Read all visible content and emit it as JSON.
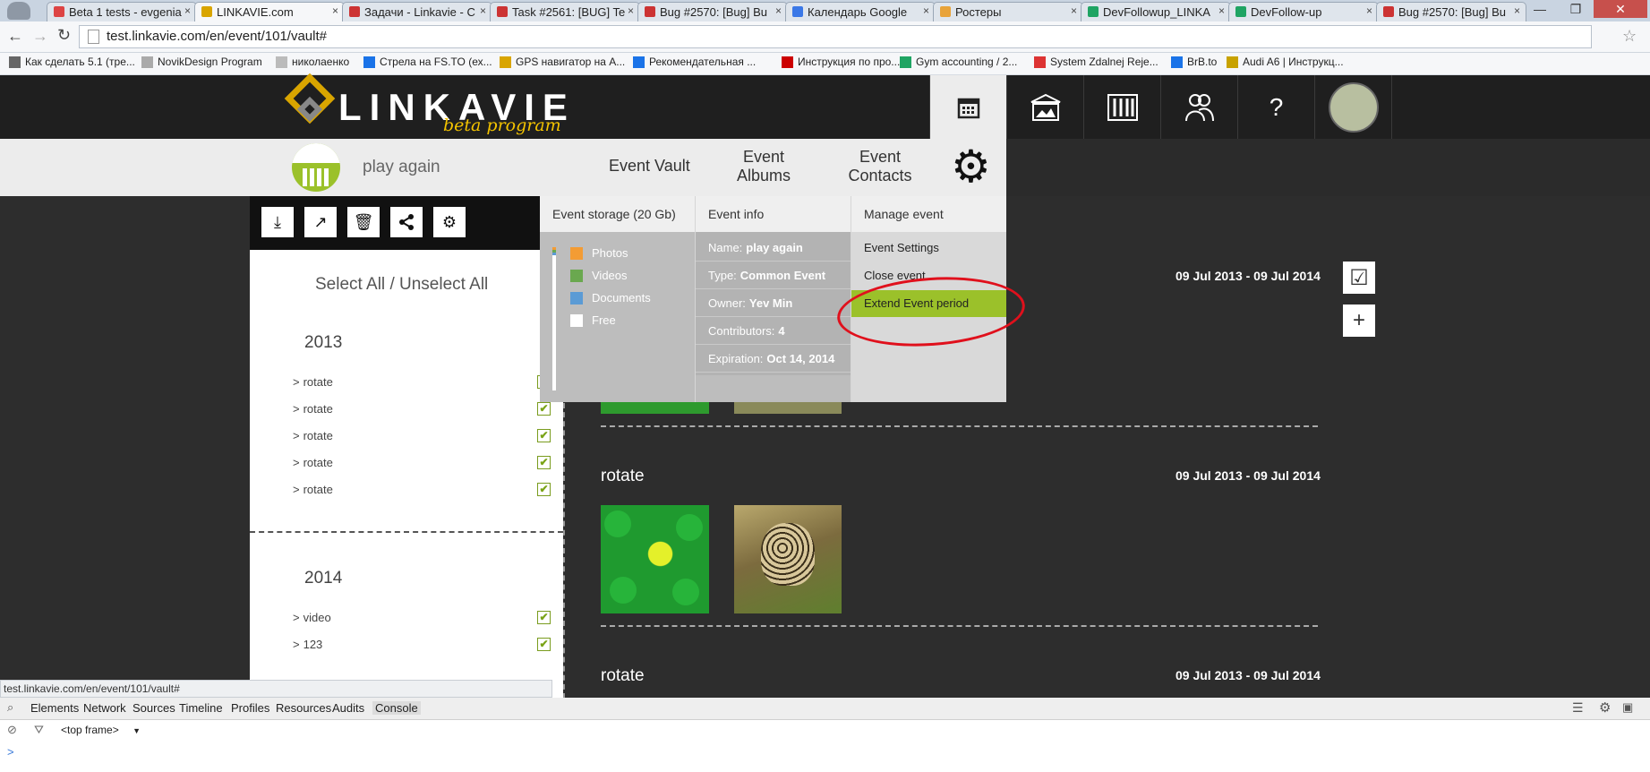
{
  "browser": {
    "tabs": [
      {
        "title": "Beta 1 tests - evgenia",
        "fav": "#d44"
      },
      {
        "title": "LINKAVIE.com",
        "fav": "#d9a500"
      },
      {
        "title": "Задачи - Linkavie - С",
        "fav": "#c33"
      },
      {
        "title": "Task #2561: [BUG] Te",
        "fav": "#c33"
      },
      {
        "title": "Bug #2570: [Bug] Bu",
        "fav": "#c33"
      },
      {
        "title": "Календарь Google",
        "fav": "#3b78e7"
      },
      {
        "title": "Ростеры",
        "fav": "#e8a33a"
      },
      {
        "title": "DevFollowup_LINKA",
        "fav": "#1fa463"
      },
      {
        "title": "DevFollow-up",
        "fav": "#1fa463"
      },
      {
        "title": "Bug #2570: [Bug] Bu",
        "fav": "#c33"
      }
    ],
    "url": "test.linkavie.com/en/event/101/vault#",
    "bookmarks": [
      "Как сделать 5.1 (тре...",
      "NovikDesign Program",
      "николаенко",
      "Стрела на FS.TO (ех...",
      "GPS навигатор на А...",
      "Рекомендательная ...",
      "Инструкция по про...",
      "Gym accounting / 2...",
      "System Zdalnej Reje...",
      "BrB.to",
      "Audi A6 | Инструкц..."
    ]
  },
  "site": {
    "logo": "LINKAVIE",
    "logo_sub": "beta program",
    "header_icons": [
      "calendar-icon",
      "photo-vault-icon",
      "albums-icon",
      "contacts-icon",
      "help-icon",
      "avatar"
    ],
    "help_label": "?",
    "event_name": "play again",
    "nav": {
      "vault": "Event Vault",
      "albums_1": "Event",
      "albums_2": "Albums",
      "contacts_1": "Event",
      "contacts_2": "Contacts"
    }
  },
  "left": {
    "select_all": "Select All",
    "sep": "/",
    "unselect_all": "Unselect All",
    "year_2013": "2013",
    "items_2013": [
      "rotate",
      "rotate",
      "rotate",
      "rotate",
      "rotate"
    ],
    "year_2014": "2014",
    "items_2014": [
      "video",
      "123"
    ],
    "prefix": ">"
  },
  "content": {
    "sections": [
      {
        "title": "rotate",
        "date": "09 Jul 2013 - 09 Jul 2014"
      },
      {
        "title": "rotate",
        "date": "09 Jul 2013 - 09 Jul 2014"
      },
      {
        "title": "rotate",
        "date": "09 Jul 2013 - 09 Jul 2014"
      }
    ]
  },
  "dropdown": {
    "storage_title": "Event storage (20 Gb)",
    "legend": [
      {
        "label": "Photos",
        "color": "#f39c34"
      },
      {
        "label": "Videos",
        "color": "#6aa84f"
      },
      {
        "label": "Documents",
        "color": "#5b9bd5"
      },
      {
        "label": "Free",
        "color": "#ffffff"
      }
    ],
    "info_title": "Event info",
    "info": [
      {
        "k": "Name:",
        "v": "play again"
      },
      {
        "k": "Type:",
        "v": "Common Event"
      },
      {
        "k": "Owner:",
        "v": "Yev Min"
      },
      {
        "k": "Contributors:",
        "v": "4"
      },
      {
        "k": "Expiration:",
        "v": "Oct 14, 2014"
      }
    ],
    "manage_title": "Manage event",
    "manage": [
      "Event Settings",
      "Close event",
      "Extend Event period"
    ],
    "highlight_color": "#9bc12a",
    "annotation_color": "#e0101c"
  },
  "status_url": "test.linkavie.com/en/event/101/vault#",
  "devtools": {
    "tabs": [
      "Elements",
      "Network",
      "Sources",
      "Timeline",
      "Profiles",
      "Resources",
      "Audits",
      "Console"
    ],
    "frame": "<top frame>",
    "prompt": ">"
  }
}
